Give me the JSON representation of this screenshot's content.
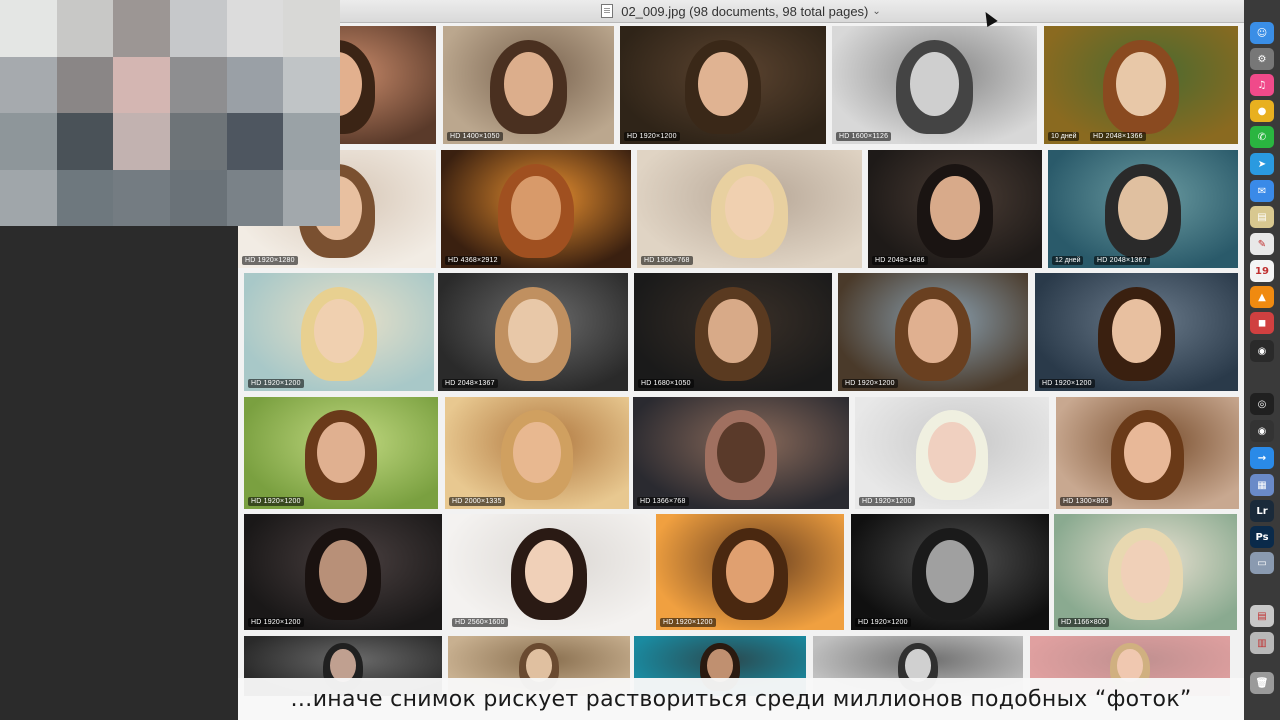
{
  "window": {
    "title": "02_009.jpg (98 documents, 98 total pages)",
    "doc_icon": "document-icon",
    "dropdown_icon": "chevron-down-icon"
  },
  "caption": "…иначе снимок рискует раствориться среди миллионов подобных “фоток”",
  "rows": [
    {
      "tiles": [
        {
          "badge": "",
          "c1": "#5a3a2a",
          "c2": "#c88a6a",
          "skin": "#e2b08e",
          "hair": "#3b2415"
        },
        {
          "badge": "HD 1400×1050",
          "c1": "#bba78e",
          "c2": "#7a6450",
          "skin": "#dcae8c",
          "hair": "#4a3020"
        },
        {
          "badge": "HD 1920×1200",
          "c1": "#2f2418",
          "c2": "#5c4430",
          "skin": "#e0b392",
          "hair": "#3a2818"
        },
        {
          "badge": "HD 1600×1126",
          "c1": "#d8d8d8",
          "c2": "#888888",
          "skin": "#cfcfcf",
          "hair": "#444"
        },
        {
          "badge": "HD 2048×1366",
          "badge_extra": "10 дней",
          "c1": "#8a6a20",
          "c2": "#4a6a30",
          "skin": "#e8c8a8",
          "hair": "#8a4a20"
        }
      ]
    },
    {
      "tiles": [
        {
          "badge": "HD 1920×1280",
          "c1": "#f2ece4",
          "c2": "#d8c8b8",
          "skin": "#e8c0a0",
          "hair": "#7a5030"
        },
        {
          "badge": "HD 4368×2912",
          "c1": "#3a2010",
          "c2": "#e89030",
          "skin": "#d89a6a",
          "hair": "#a05020"
        },
        {
          "badge": "HD 1360×768",
          "c1": "#e0d4c4",
          "c2": "#b8a898",
          "skin": "#f0d0b0",
          "hair": "#e8d0a0"
        },
        {
          "badge": "HD 2048×1486",
          "c1": "#1e1a18",
          "c2": "#4a3c34",
          "skin": "#d8aa8a",
          "hair": "#1a1412"
        },
        {
          "badge": "HD 2048×1367",
          "badge_extra": "12 дней",
          "c1": "#2a5a6a",
          "c2": "#6a9aa0",
          "skin": "#e0c0a0",
          "hair": "#2a2a2a"
        }
      ]
    },
    {
      "tiles": [
        {
          "badge": "HD 1920×1200",
          "c1": "#a8c8c8",
          "c2": "#e8e0c8",
          "skin": "#f0d0b0",
          "hair": "#e8d090"
        },
        {
          "badge": "HD 2048×1367",
          "c1": "#2a2a2a",
          "c2": "#6a6a6a",
          "skin": "#e8c8a8",
          "hair": "#c09060"
        },
        {
          "badge": "HD 1680×1050",
          "c1": "#1a1a1a",
          "c2": "#3a3028",
          "skin": "#d8aa88",
          "hair": "#5a3a20"
        },
        {
          "badge": "HD 1920×1200",
          "c1": "#4a3a2a",
          "c2": "#8aa0b0",
          "skin": "#e0b090",
          "hair": "#6a4020"
        },
        {
          "badge": "HD 1920×1200",
          "c1": "#2a3a4a",
          "c2": "#6a7a8a",
          "skin": "#e8c0a0",
          "hair": "#3a2010"
        }
      ]
    },
    {
      "tiles": [
        {
          "badge": "HD 1920×1200",
          "c1": "#7aa040",
          "c2": "#c0d880",
          "skin": "#e0b090",
          "hair": "#6a3a1a"
        },
        {
          "badge": "HD 2000×1335",
          "c1": "#e8c890",
          "c2": "#b07840",
          "skin": "#e8b890",
          "hair": "#d0a060"
        },
        {
          "badge": "HD 1366×768",
          "c1": "#2a2a30",
          "c2": "#8a6a5a",
          "skin": "#5a3a2a",
          "hair": "#a07060"
        },
        {
          "badge": "HD 1920×1200",
          "c1": "#e8e8e8",
          "c2": "#c8c8c8",
          "skin": "#f0d0c0",
          "hair": "#f0f0e0"
        },
        {
          "badge": "HD 1300×865",
          "c1": "#c8a890",
          "c2": "#7a5030",
          "skin": "#e8b898",
          "hair": "#6a3a18"
        }
      ]
    },
    {
      "tiles": [
        {
          "badge": "HD 1920×1200",
          "c1": "#1a1818",
          "c2": "#4a4040",
          "skin": "#b89078",
          "hair": "#1a1210"
        },
        {
          "badge": "HD 2560×1600",
          "c1": "#f4f2f0",
          "c2": "#dcd8d4",
          "skin": "#f0d0b8",
          "hair": "#2a1a14"
        },
        {
          "badge": "HD 1920×1200",
          "c1": "#f0a040",
          "c2": "#6a4020",
          "skin": "#e0a070",
          "hair": "#4a2810"
        },
        {
          "badge": "HD 1920×1200",
          "c1": "#101010",
          "c2": "#505050",
          "skin": "#a0a0a0",
          "hair": "#1a1a1a"
        },
        {
          "badge": "HD 1166×800",
          "c1": "#8aaa90",
          "c2": "#e8e0d0",
          "skin": "#f0d0b8",
          "hair": "#e8d8b0"
        }
      ]
    },
    {
      "tiles": [
        {
          "badge": "",
          "c1": "#2a2a2a",
          "c2": "#6a6a6a",
          "skin": "#c0a090",
          "hair": "#202020"
        },
        {
          "badge": "",
          "c1": "#c8b090",
          "c2": "#8a7050",
          "skin": "#e0c0a0",
          "hair": "#6a4a30"
        },
        {
          "badge": "",
          "c1": "#1a8aa0",
          "c2": "#2a4a50",
          "skin": "#c09070",
          "hair": "#2a1a10"
        },
        {
          "badge": "",
          "c1": "#c0c0c0",
          "c2": "#707070",
          "skin": "#d0d0d0",
          "hair": "#303030"
        },
        {
          "badge": "",
          "c1": "#e0a0a0",
          "c2": "#c09090",
          "skin": "#f0c8b0",
          "hair": "#d0b080"
        }
      ]
    }
  ],
  "dock": [
    {
      "name": "finder-icon",
      "glyph": "☺",
      "color": "#3a8ee6"
    },
    {
      "name": "system-preferences-icon",
      "glyph": "⚙",
      "color": "#777777"
    },
    {
      "name": "itunes-icon",
      "glyph": "♫",
      "color": "#f04a8a"
    },
    {
      "name": "chrome-icon",
      "glyph": "●",
      "color": "#e8b020"
    },
    {
      "name": "whatsapp-icon",
      "glyph": "✆",
      "color": "#2ab540"
    },
    {
      "name": "telegram-icon",
      "glyph": "➤",
      "color": "#2a9ae0"
    },
    {
      "name": "messenger-icon",
      "glyph": "✉",
      "color": "#3a8ae8"
    },
    {
      "name": "notes-icon",
      "glyph": "▤",
      "color": "#d8c890"
    },
    {
      "name": "textedit-icon",
      "glyph": "✎",
      "color": "#e8e8e8"
    },
    {
      "name": "calendar-icon",
      "glyph": "19",
      "color": "#f4f4f4"
    },
    {
      "name": "vlc-icon",
      "glyph": "▲",
      "color": "#f08a10"
    },
    {
      "name": "photo-booth-icon",
      "glyph": "◼",
      "color": "#d04040"
    },
    {
      "name": "dvd-player-icon",
      "glyph": "◉",
      "color": "#2a2a2a"
    },
    {
      "name": "obs-icon",
      "glyph": "◎",
      "color": "#202020"
    },
    {
      "name": "camera-icon",
      "glyph": "◉",
      "color": "#333333"
    },
    {
      "name": "migration-icon",
      "glyph": "→",
      "color": "#2a8ae8"
    },
    {
      "name": "preview-icon",
      "glyph": "▦",
      "color": "#6a8ac8"
    },
    {
      "name": "lightroom-icon",
      "glyph": "Lr",
      "color": "#1a2a3a"
    },
    {
      "name": "photoshop-icon",
      "glyph": "Ps",
      "color": "#0a2a4a"
    },
    {
      "name": "image-capture-icon",
      "glyph": "▭",
      "color": "#8a9ab0"
    },
    {
      "name": "document-stack-icon",
      "glyph": "▤",
      "color": "#c8c8c8"
    },
    {
      "name": "folder-stack-icon",
      "glyph": "▥",
      "color": "#b8b8b8"
    },
    {
      "name": "trash-icon",
      "glyph": "🗑",
      "color": "#9a9a9a"
    }
  ]
}
